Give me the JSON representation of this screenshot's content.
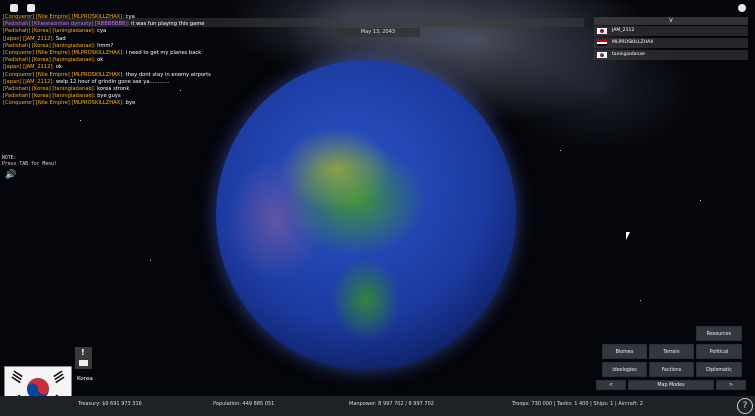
{
  "colors": {
    "tag": "#ffb000",
    "tag_purple": "#c06cff",
    "korea_red": "#cd2e3a",
    "korea_blue": "#0047a0"
  },
  "chat": [
    {
      "tag": "[Conqueror] [Nile Empire] [MLPROSKILLZHAX]:",
      "msg": "cya"
    },
    {
      "tag": "[Padishah] [Khwarazmian dynasty] [RBBBBBBB]:",
      "msg": "it was fun playing this game"
    },
    {
      "tag": "[Padishah] [Korea] [taningiadanae]:",
      "msg": "cya"
    },
    {
      "tag": "[Japan] [JAM_2112]:",
      "msg": "Sad"
    },
    {
      "tag": "[Padishah] [Korea] [taningiadanae]:",
      "msg": "hmm?"
    },
    {
      "tag": "[Conqueror] [Nile Empire] [MLPROSKILLZHAX]:",
      "msg": "i need to get my planes back"
    },
    {
      "tag": "[Padishah] [Korea] [taningiadanae]:",
      "msg": "ok"
    },
    {
      "tag": "[Japan] [JAM_2112]:",
      "msg": "ok"
    },
    {
      "tag": "[Conqueror] [Nile Empire] [MLPROSKILLZHAX]:",
      "msg": "they dont stay in enemy airports"
    },
    {
      "tag": "[Japan] [JAM_2112]:",
      "msg": "welp 12 hour of grindin gone see ya............"
    },
    {
      "tag": "[Padishah] [Korea] [taningiadanae]:",
      "msg": "korea stronk"
    },
    {
      "tag": "[Padishah] [Korea] [taningiadanae]:",
      "msg": "bye guys"
    },
    {
      "tag": "[Conqueror] [Nile Empire] [MLPROSKILLZHAX]:",
      "msg": "bye"
    }
  ],
  "date": "May 13, 2043",
  "players_header": "V",
  "players": [
    {
      "name": "JAM_2112",
      "flag": "japan"
    },
    {
      "name": "MLPROSKILLZHAX",
      "flag": "nile"
    },
    {
      "name": "taningiadanae",
      "flag": "korea"
    }
  ],
  "note": "NOTE:\nPress TAB for Menu!",
  "country": "Korea",
  "buttons": {
    "resources": "Resources",
    "biomes": "Biomes",
    "terrain": "Terrain",
    "political": "Political",
    "ideologies": "Ideologies",
    "factions": "Factions",
    "diplomatic": "Diplomatic",
    "prev": "<",
    "map_modes": "Map Modes",
    "next": ">"
  },
  "stats": {
    "treasury": "Treasury:   $9 691 973 316",
    "population": "Population: 449 885 051",
    "manpower": "Manpower:   8 997 702  /  8 997 702",
    "military": "Troops: 730 000  |  Tanks: 1 400  |  Ships: 1  |  Aircraft: 2"
  },
  "help": "?"
}
